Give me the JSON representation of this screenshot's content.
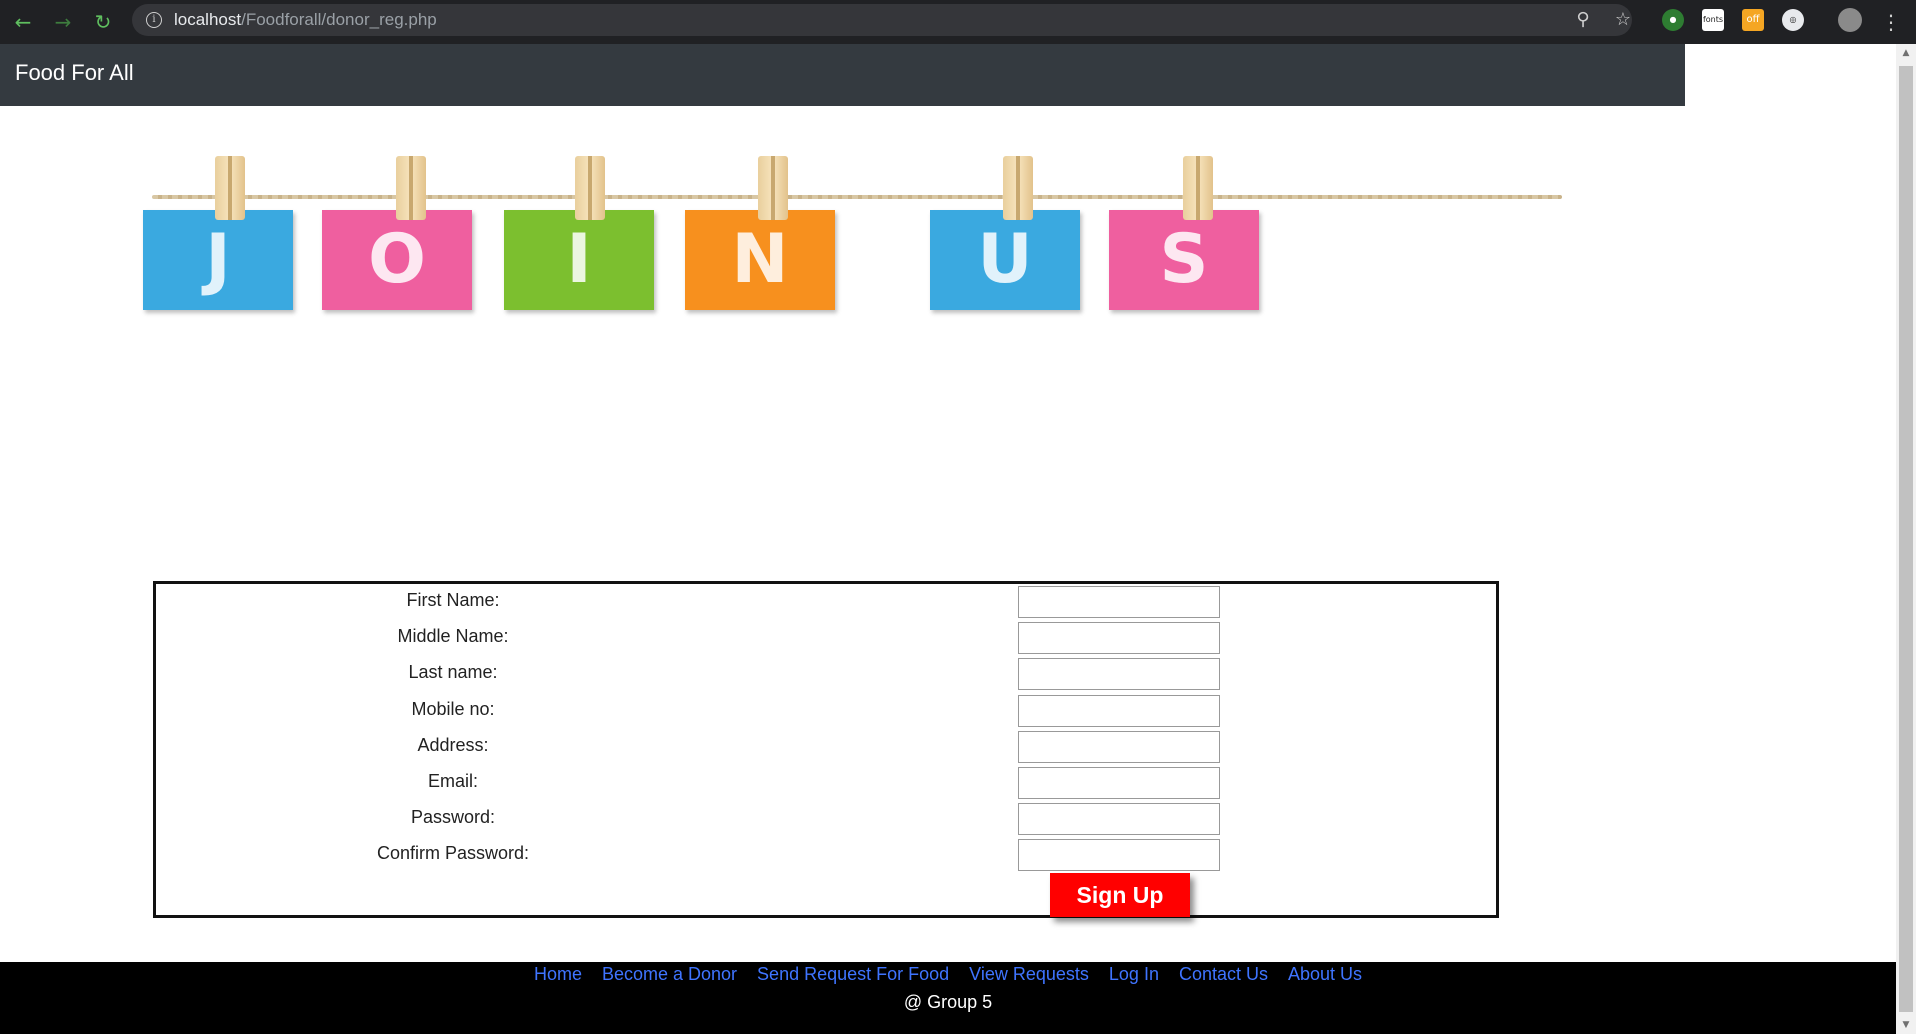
{
  "browser": {
    "url_host": "localhost",
    "url_path": "/Foodforall/donor_reg.php",
    "extension_label": "fonts",
    "extension_badge": "off"
  },
  "navbar": {
    "brand": "Food For All"
  },
  "banner": {
    "letters": [
      "J",
      "O",
      "I",
      "N",
      "U",
      "S"
    ],
    "colors": [
      "#3aa9e0",
      "#ef5f9f",
      "#7cbf2f",
      "#f7901e",
      "#3aa9e0",
      "#ef5f9f"
    ]
  },
  "form": {
    "fields": [
      {
        "label": "First Name:",
        "value": ""
      },
      {
        "label": "Middle Name:",
        "value": ""
      },
      {
        "label": "Last name:",
        "value": ""
      },
      {
        "label": "Mobile no:",
        "value": ""
      },
      {
        "label": "Address:",
        "value": ""
      },
      {
        "label": "Email:",
        "value": ""
      },
      {
        "label": "Password:",
        "value": ""
      },
      {
        "label": "Confirm Password:",
        "value": ""
      }
    ],
    "submit_label": "Sign Up",
    "submit_color": "#ff0000"
  },
  "footer": {
    "links": [
      "Home",
      "Become a Donor",
      "Send Request For Food",
      "View Requests",
      "Log In",
      "Contact Us",
      "About Us"
    ],
    "copyright": "@ Group 5"
  }
}
